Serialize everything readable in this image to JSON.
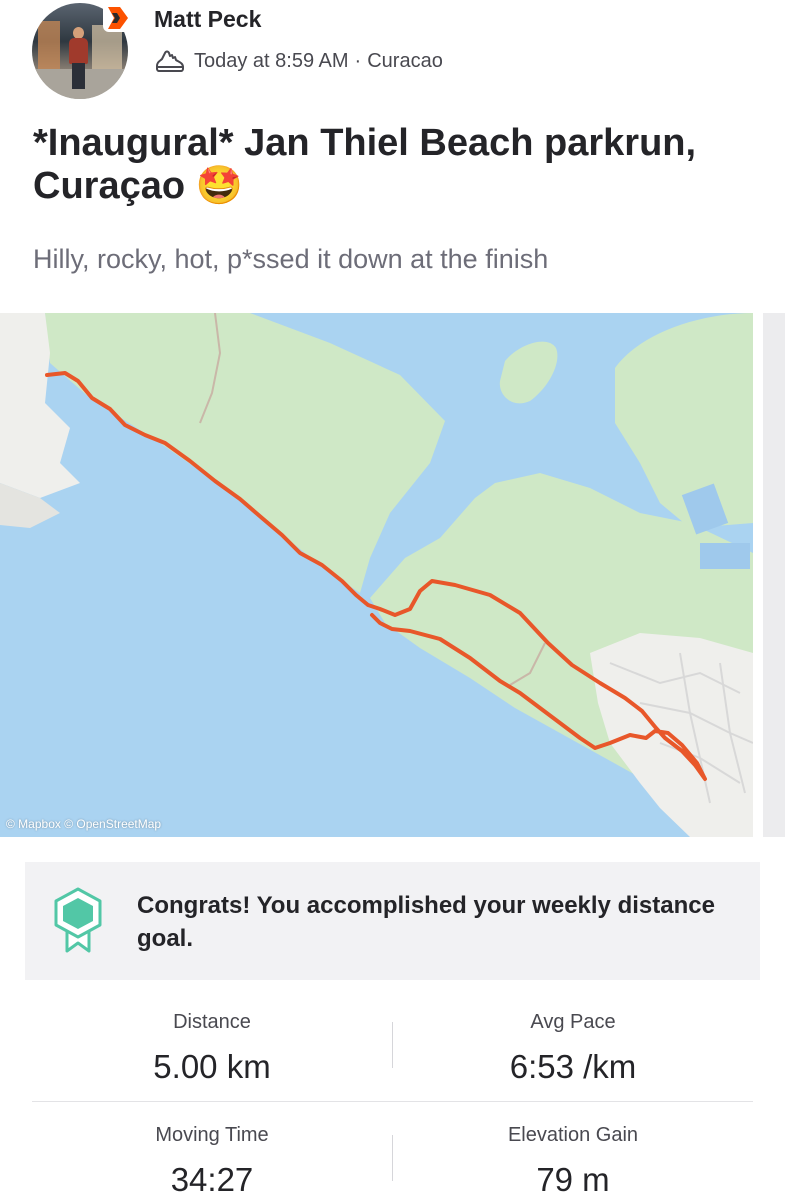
{
  "header": {
    "user_name": "Matt Peck",
    "avatar_icon": "user-avatar",
    "badge_icon": "strava-subscriber-badge",
    "activity_icon": "running-shoe-icon",
    "timestamp": "Today at 8:59 AM",
    "separator": "·",
    "location": "Curacao"
  },
  "activity": {
    "title": "*Inaugural* Jan Thiel Beach parkrun, Curaçao 🤩",
    "description": "Hilly, rocky, hot, p*ssed it down at the finish"
  },
  "map": {
    "attribution": "© Mapbox © OpenStreetMap",
    "route_color": "#e8572a",
    "water_color": "#aad3f1",
    "land_color": "#cfe8c6"
  },
  "goal": {
    "icon": "goal-hexagon-ribbon-icon",
    "message": "Congrats! You accomplished your weekly distance goal.",
    "accent_color": "#52c7a6"
  },
  "stats": [
    {
      "label": "Distance",
      "value": "5.00 km"
    },
    {
      "label": "Avg Pace",
      "value": "6:53 /km"
    },
    {
      "label": "Moving Time",
      "value": "34:27"
    },
    {
      "label": "Elevation Gain",
      "value": "79 m"
    }
  ]
}
